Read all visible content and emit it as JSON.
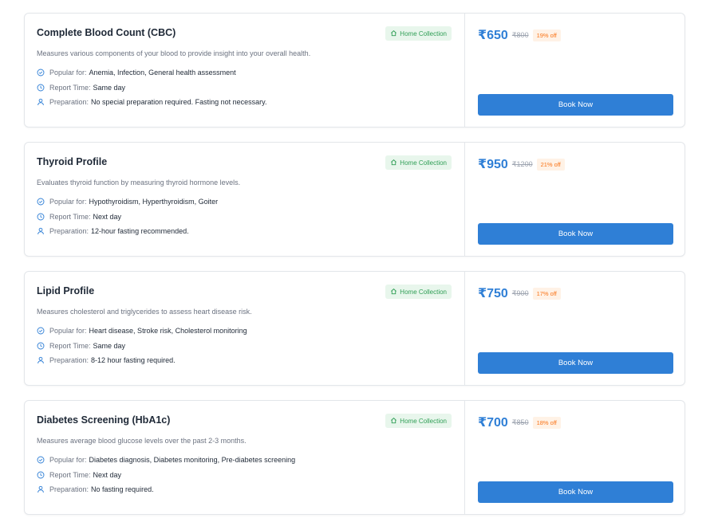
{
  "tests": [
    {
      "name": "Complete Blood Count (CBC)",
      "badge": "Home Collection",
      "description": "Measures various components of your blood to provide insight into your overall health.",
      "popular_label": "Popular for:",
      "popular": "Anemia, Infection, General health assessment",
      "report_label": "Report Time:",
      "report": "Same day",
      "prep_label": "Preparation:",
      "prep": "No special preparation required. Fasting not necessary.",
      "price": "₹650",
      "mrp": "₹800",
      "discount": "19% off",
      "button": "Book Now"
    },
    {
      "name": "Thyroid Profile",
      "badge": "Home Collection",
      "description": "Evaluates thyroid function by measuring thyroid hormone levels.",
      "popular_label": "Popular for:",
      "popular": "Hypothyroidism, Hyperthyroidism, Goiter",
      "report_label": "Report Time:",
      "report": "Next day",
      "prep_label": "Preparation:",
      "prep": "12-hour fasting recommended.",
      "price": "₹950",
      "mrp": "₹1200",
      "discount": "21% off",
      "button": "Book Now"
    },
    {
      "name": "Lipid Profile",
      "badge": "Home Collection",
      "description": "Measures cholesterol and triglycerides to assess heart disease risk.",
      "popular_label": "Popular for:",
      "popular": "Heart disease, Stroke risk, Cholesterol monitoring",
      "report_label": "Report Time:",
      "report": "Same day",
      "prep_label": "Preparation:",
      "prep": "8-12 hour fasting required.",
      "price": "₹750",
      "mrp": "₹900",
      "discount": "17% off",
      "button": "Book Now"
    },
    {
      "name": "Diabetes Screening (HbA1c)",
      "badge": "Home Collection",
      "description": "Measures average blood glucose levels over the past 2-3 months.",
      "popular_label": "Popular for:",
      "popular": "Diabetes diagnosis, Diabetes monitoring, Pre-diabetes screening",
      "report_label": "Report Time:",
      "report": "Next day",
      "prep_label": "Preparation:",
      "prep": "No fasting required.",
      "price": "₹700",
      "mrp": "₹850",
      "discount": "18% off",
      "button": "Book Now"
    }
  ],
  "icons": {
    "badge": "home-icon",
    "popular": "check-circle-icon",
    "report": "clock-icon",
    "prep": "user-icon"
  },
  "colors": {
    "accent": "#2f7fd6",
    "badge_bg": "#e8f6ec",
    "badge_text": "#2f9e55",
    "discount_text": "#f97316",
    "discount_bg": "#fff2e6"
  }
}
